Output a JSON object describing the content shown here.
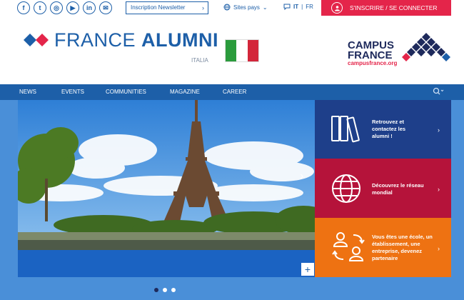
{
  "topbar": {
    "socials": [
      {
        "icon": "facebook-icon",
        "glyph": "f"
      },
      {
        "icon": "twitter-icon",
        "glyph": "t"
      },
      {
        "icon": "instagram-icon",
        "glyph": "◎"
      },
      {
        "icon": "youtube-icon",
        "glyph": "▶"
      },
      {
        "icon": "linkedin-icon",
        "glyph": "in"
      },
      {
        "icon": "email-icon",
        "glyph": "✉"
      }
    ],
    "newsletter_label": "Inscription Newsletter",
    "sites_label": "Sites pays",
    "lang_current": "IT",
    "lang_separator": "|",
    "lang_other": "FR",
    "signin_label": "S'INSCRIRE / SE CONNECTER"
  },
  "header": {
    "brand_light": "FRANCE ",
    "brand_bold": "ALUMNI",
    "country": "ITALIA",
    "partner_line1": "CAMPUS",
    "partner_line2": "FRANCE",
    "partner_url": "campusfrance.org"
  },
  "nav": {
    "items": [
      "NEWS",
      "EVENTS",
      "COMMUNITIES",
      "MAGAZINE",
      "CAREER"
    ]
  },
  "cards": [
    {
      "text": "Retrouvez et contactez les alumni !",
      "icon": "books-icon",
      "color": "#1e3f8a"
    },
    {
      "text": "Découvrez le réseau mondial",
      "icon": "globe-icon",
      "color": "#b5133a"
    },
    {
      "text": "Vous êtes une école, un établissement, une entreprise, devenez partenaire",
      "icon": "people-exchange-icon",
      "color": "#ee7212"
    }
  ],
  "colors": {
    "primary": "#1d5fa8",
    "accent": "#e4254a",
    "navy": "#1e2a5c"
  },
  "carousel": {
    "slides": 3,
    "active": 1
  }
}
